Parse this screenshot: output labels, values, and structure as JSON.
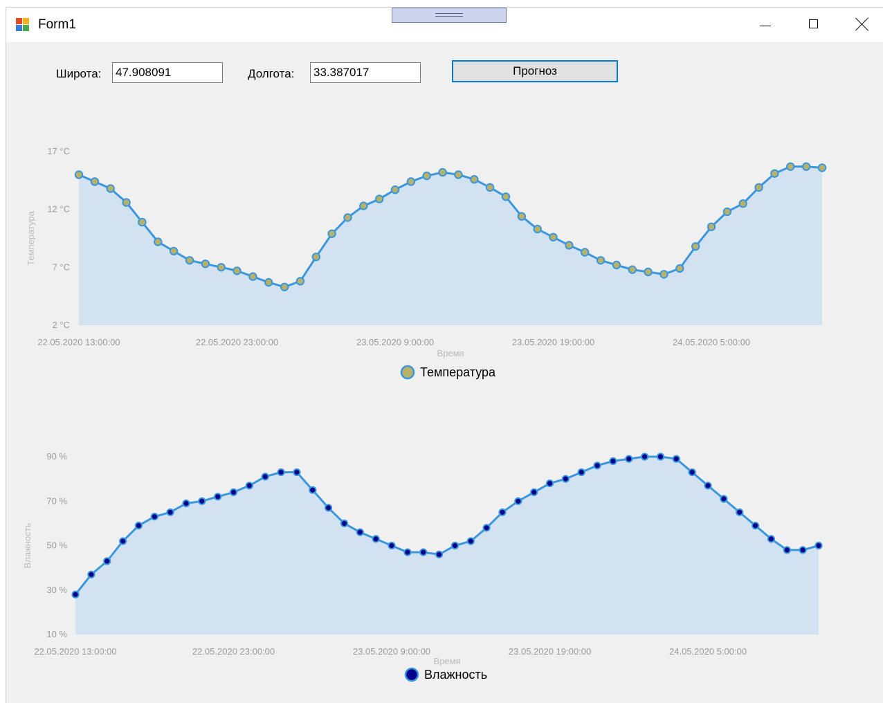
{
  "window": {
    "title": "Form1"
  },
  "form": {
    "lat_label": "Широта:",
    "lat_value": "47.908091",
    "lon_label": "Долгота:",
    "lon_value": "33.387017",
    "forecast_button": "Прогноз"
  },
  "chart_data": [
    {
      "type": "area",
      "xlabel": "Время",
      "ylabel": "Температура",
      "x_tick_labels": [
        "22.05.2020 13:00:00",
        "22.05.2020 23:00:00",
        "23.05.2020 9:00:00",
        "23.05.2020 19:00:00",
        "24.05.2020 5:00:00"
      ],
      "y_tick_labels": [
        "2 °C",
        "7 °C",
        "12 °C",
        "17 °C"
      ],
      "ylim": [
        2,
        17
      ],
      "legend_position": "bottom",
      "series": [
        {
          "name": "Температура",
          "line_color": "#3a96dd",
          "fill_color": "#d2e2f0",
          "marker_color": "#b7b169",
          "values": [
            15.0,
            14.4,
            13.8,
            12.6,
            10.9,
            9.2,
            8.4,
            7.6,
            7.3,
            7.0,
            6.7,
            6.2,
            5.7,
            5.3,
            5.8,
            7.9,
            9.9,
            11.3,
            12.3,
            12.9,
            13.7,
            14.4,
            14.9,
            15.2,
            15.0,
            14.6,
            13.9,
            13.1,
            11.4,
            10.3,
            9.6,
            8.9,
            8.3,
            7.6,
            7.2,
            6.8,
            6.6,
            6.4,
            6.9,
            8.8,
            10.5,
            11.8,
            12.5,
            13.9,
            15.1,
            15.7,
            15.7,
            15.6
          ]
        }
      ]
    },
    {
      "type": "area",
      "xlabel": "Время",
      "ylabel": "Влажность",
      "x_tick_labels": [
        "22.05.2020 13:00:00",
        "22.05.2020 23:00:00",
        "23.05.2020 9:00:00",
        "23.05.2020 19:00:00",
        "24.05.2020 5:00:00"
      ],
      "y_tick_labels": [
        "10 %",
        "30 %",
        "50 %",
        "70 %",
        "90 %"
      ],
      "ylim": [
        10,
        90
      ],
      "legend_position": "bottom",
      "series": [
        {
          "name": "Влажность",
          "line_color": "#3a96dd",
          "fill_color": "#d2e2f0",
          "marker_color": "#00008b",
          "values": [
            28,
            37,
            43,
            52,
            59,
            63,
            65,
            69,
            70,
            72,
            74,
            77,
            81,
            83,
            83,
            75,
            67,
            60,
            56,
            53,
            50,
            47,
            47,
            46,
            50,
            52,
            58,
            65,
            70,
            74,
            78,
            80,
            83,
            86,
            88,
            89,
            90,
            90,
            89,
            83,
            77,
            71,
            65,
            59,
            53,
            48,
            48,
            50
          ]
        }
      ]
    }
  ]
}
